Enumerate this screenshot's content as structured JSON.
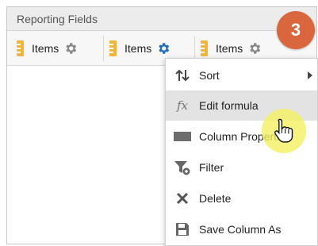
{
  "panel": {
    "title": "Reporting Fields",
    "fields": [
      {
        "label": "Items",
        "icon": "ruler-icon",
        "gear_color": "#8a8a8a"
      },
      {
        "label": "Items",
        "icon": "ruler-icon",
        "gear_color": "#1f6fc3"
      },
      {
        "label": "Items",
        "icon": "ruler-icon",
        "gear_color": "#8a8a8a"
      }
    ]
  },
  "step_badge": "3",
  "context_menu": {
    "items": [
      {
        "label": "Sort",
        "icon": "sort-icon"
      },
      {
        "label": "Edit formula",
        "icon": "fx-icon",
        "highlighted": true
      },
      {
        "label": "Column Properties",
        "icon": "xyz-icon"
      },
      {
        "label": "Filter",
        "icon": "filter-icon"
      },
      {
        "label": "Delete",
        "icon": "delete-icon"
      },
      {
        "label": "Save Column As",
        "icon": "save-icon"
      }
    ]
  },
  "colors": {
    "accent_gear": "#1f6fc3",
    "badge": "#d9663c",
    "ruler": "#f2b53b",
    "cursor_highlight": "#f4f060"
  }
}
